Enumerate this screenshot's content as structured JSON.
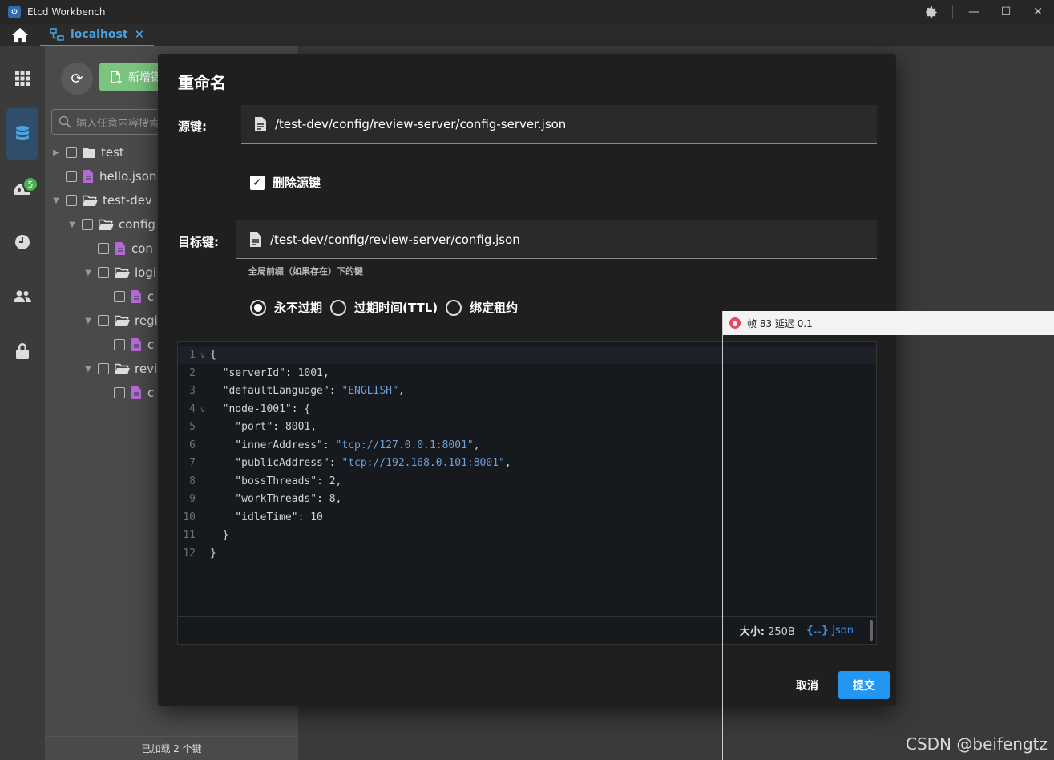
{
  "window": {
    "title": "Etcd Workbench"
  },
  "tabs": [
    {
      "label": "localhost"
    }
  ],
  "toolbar": {
    "add_label": "新增键",
    "search_placeholder": "输入任意内容搜索"
  },
  "rail": {
    "badge_count": "5"
  },
  "tree": {
    "items": [
      {
        "label": "test",
        "type": "folder",
        "expanded": false
      },
      {
        "label": "hello.json",
        "type": "file"
      },
      {
        "label": "test-dev",
        "type": "folder",
        "expanded": true
      },
      {
        "label": "config",
        "type": "folder",
        "expanded": true
      },
      {
        "label": "con",
        "type": "file"
      },
      {
        "label": "logi",
        "type": "folder",
        "expanded": true
      },
      {
        "label": "c",
        "type": "file"
      },
      {
        "label": "regi",
        "type": "folder",
        "expanded": true
      },
      {
        "label": "c",
        "type": "file"
      },
      {
        "label": "revi",
        "type": "folder",
        "expanded": true
      },
      {
        "label": "c",
        "type": "file"
      }
    ],
    "footer": "已加载 2 个键"
  },
  "dialog": {
    "title": "重命名",
    "source_label": "源键:",
    "source_value": "/test-dev/config/review-server/config-server.json",
    "delete_source_label": "删除源键",
    "delete_source_checked": true,
    "target_label": "目标键:",
    "target_value": "/test-dev/config/review-server/config.json",
    "target_hint": "全局前缀（如果存在）下的键",
    "ttl_options": [
      {
        "label": "永不过期",
        "selected": true
      },
      {
        "label": "过期时间(TTL)",
        "selected": false
      },
      {
        "label": "绑定租约",
        "selected": false
      }
    ],
    "editor": {
      "lines": [
        {
          "n": "1",
          "fold": true,
          "parts": [
            [
              "code",
              "{"
            ]
          ]
        },
        {
          "n": "2",
          "fold": false,
          "parts": [
            [
              "k",
              "  \"serverId\""
            ],
            [
              "code",
              ": "
            ],
            [
              "n",
              "1001"
            ],
            [
              "code",
              ","
            ]
          ]
        },
        {
          "n": "3",
          "fold": false,
          "parts": [
            [
              "k",
              "  \"defaultLanguage\""
            ],
            [
              "code",
              ": "
            ],
            [
              "s",
              "\"ENGLISH\""
            ],
            [
              "code",
              ","
            ]
          ]
        },
        {
          "n": "4",
          "fold": true,
          "parts": [
            [
              "k",
              "  \"node-1001\""
            ],
            [
              "code",
              ": {"
            ]
          ]
        },
        {
          "n": "5",
          "fold": false,
          "parts": [
            [
              "k",
              "    \"port\""
            ],
            [
              "code",
              ": "
            ],
            [
              "n",
              "8001"
            ],
            [
              "code",
              ","
            ]
          ]
        },
        {
          "n": "6",
          "fold": false,
          "parts": [
            [
              "k",
              "    \"innerAddress\""
            ],
            [
              "code",
              ": "
            ],
            [
              "s",
              "\"tcp://127.0.0.1:8001\""
            ],
            [
              "code",
              ","
            ]
          ]
        },
        {
          "n": "7",
          "fold": false,
          "parts": [
            [
              "k",
              "    \"publicAddress\""
            ],
            [
              "code",
              ": "
            ],
            [
              "s",
              "\"tcp://192.168.0.101:8001\""
            ],
            [
              "code",
              ","
            ]
          ]
        },
        {
          "n": "8",
          "fold": false,
          "parts": [
            [
              "k",
              "    \"bossThreads\""
            ],
            [
              "code",
              ": "
            ],
            [
              "n",
              "2"
            ],
            [
              "code",
              ","
            ]
          ]
        },
        {
          "n": "9",
          "fold": false,
          "parts": [
            [
              "k",
              "    \"workThreads\""
            ],
            [
              "code",
              ": "
            ],
            [
              "n",
              "8"
            ],
            [
              "code",
              ","
            ]
          ]
        },
        {
          "n": "10",
          "fold": false,
          "parts": [
            [
              "k",
              "    \"idleTime\""
            ],
            [
              "code",
              ": "
            ],
            [
              "n",
              "10"
            ]
          ]
        },
        {
          "n": "11",
          "fold": false,
          "parts": [
            [
              "code",
              "  }"
            ]
          ]
        },
        {
          "n": "12",
          "fold": false,
          "parts": [
            [
              "code",
              "}"
            ]
          ]
        }
      ],
      "size_label": "大小:",
      "size_value": "250B",
      "format_label": "Json"
    },
    "cancel_label": "取消",
    "submit_label": "提交"
  },
  "overlay": {
    "text": "帧 83 延迟 0.1"
  },
  "watermark": "CSDN @beifengtz",
  "colors": {
    "accent": "#2196f3",
    "tab_accent": "#4aa3df",
    "add_button": "#7bc47f",
    "badge": "#4caf50",
    "file_icon": "#b36ad6"
  }
}
